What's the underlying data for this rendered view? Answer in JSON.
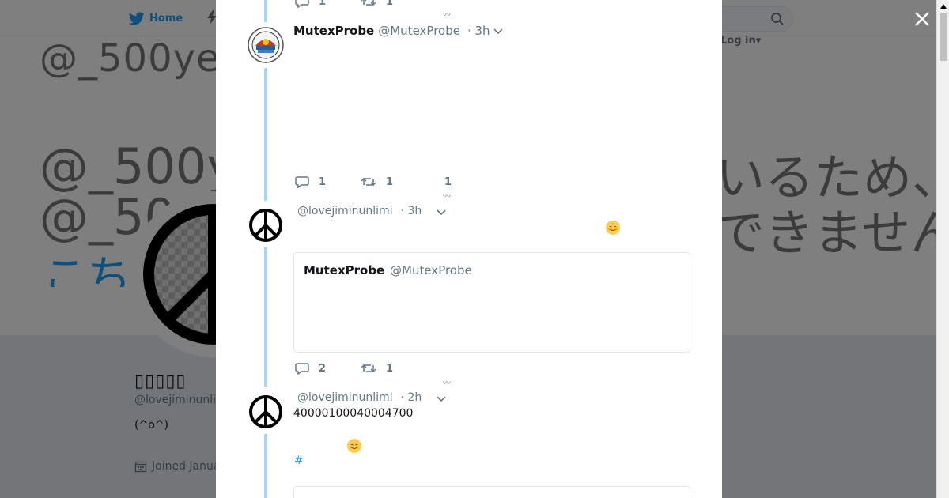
{
  "nav": {
    "home_label": "Home",
    "login_label": "Log in",
    "search_placeholder": ""
  },
  "profile": {
    "banner_line1": "@_500ye",
    "banner_line2": "@_50",
    "banner_line3": "こち",
    "banner_right1": "いるため、",
    "banner_right2": "できません。",
    "banner_top": "@_500ye",
    "name": "▯▯▯▯▯",
    "handle": "@lovejiminunli",
    "bio": "(^o^)",
    "joined": "Joined Janua"
  },
  "modal": {
    "top_actions": {
      "replies": "1",
      "retweets": "1"
    },
    "tweets": [
      {
        "name": "MutexProbe",
        "handle": "@MutexProbe",
        "time": "· 3h",
        "replies": "1",
        "retweets": "1",
        "likes": "1"
      },
      {
        "name": "",
        "handle": "@lovejiminunlimi",
        "time": "· 3h",
        "emoji": "☺",
        "quote": {
          "name": "MutexProbe",
          "handle": "@MutexProbe"
        },
        "replies": "2",
        "retweets": "1"
      },
      {
        "name": "",
        "handle": "@lovejiminunlimi",
        "time": "· 2h",
        "text": "40000100040004700",
        "emoji": "☺",
        "hashtag": "#"
      }
    ]
  },
  "colors": {
    "accent": "#1da1f2",
    "thread_line": "#a2d8f5",
    "muted": "#657786"
  }
}
